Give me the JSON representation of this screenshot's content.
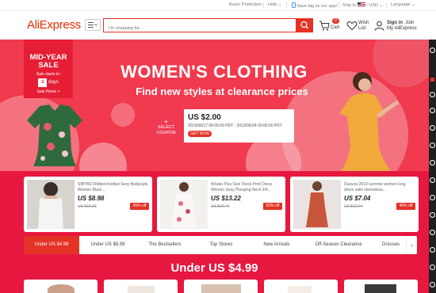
{
  "topbar": {
    "buyer_protection": "Buyer Protection",
    "help": "Help",
    "app": "Save big on our app!",
    "ship_to": "Ship to",
    "currency": "/ USD",
    "language": "Language"
  },
  "header": {
    "logo": "AliExpress",
    "search_placeholder": "I'm shopping for...",
    "cart_label": "Cart",
    "cart_count": "0",
    "wish_label_1": "Wish",
    "wish_label_2": "List",
    "signin": "Sign in",
    "join": "Join",
    "my_account": "My AliExpress"
  },
  "banner": {
    "badge_title_1": "MID-YEAR",
    "badge_title_2": "SALE",
    "badge_starts": "Sale starts in:",
    "badge_days_num": "3",
    "badge_days_label": "days",
    "badge_link": "Sale Home >",
    "title": "WOMEN'S CLOTHING",
    "subtitle": "Find new styles at clearance prices",
    "coupon_select": "SELECT",
    "coupon_label": "COUPON",
    "coupon_amount": "US $2.00",
    "coupon_dates": "2019/06/17 00:00:00 PDT - 2019/06/24 00:00:00 PDT",
    "coupon_button": "GET NOW"
  },
  "deals": [
    {
      "title": "SIBYBO Ribbed Knitted Sexy Bodysuits Women Black...",
      "price": "US $8.98",
      "old": "US $16.33",
      "off": "45% off"
    },
    {
      "title": "Wisalo Plus Size Floral Print Dress Women Sexy Plunging Neck 3/4...",
      "price": "US $13.22",
      "old": "US $26.44",
      "off": "50% off"
    },
    {
      "title": "Dulzura 2019 summer women long dress satin sleeveless...",
      "price": "US $7.04",
      "old": "US $12.54",
      "off": "46% off"
    }
  ],
  "tabs": [
    {
      "label": "Under US $4.99"
    },
    {
      "label": "Under US $8.99"
    },
    {
      "label": "The Bestsellers"
    },
    {
      "label": "Top Stores"
    },
    {
      "label": "New Arrivals"
    },
    {
      "label": "Off-Season Clearance"
    },
    {
      "label": "Dresses"
    }
  ],
  "section_title": "Under US $4.99",
  "colors": {
    "accent": "#e43225",
    "banner": "#f13a4e",
    "deals_bg": "#e61840"
  },
  "icons": [
    "menu-icon",
    "search-icon",
    "cart-icon",
    "heart-icon",
    "user-icon",
    "phone-icon",
    "flag-icon",
    "chevron-right-icon"
  ]
}
